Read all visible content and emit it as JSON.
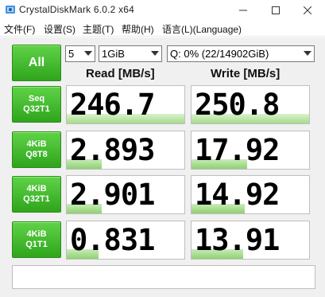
{
  "window": {
    "title": "CrystalDiskMark 6.0.2 x64"
  },
  "menu": {
    "items": [
      "文件(F)",
      "设置(S)",
      "主题(T)",
      "帮助(H)",
      "语言(L)(Language)"
    ]
  },
  "controls": {
    "all_label": "All",
    "count_value": "5",
    "size_value": "1GiB",
    "drive_value": "Q: 0% (22/14902GiB)"
  },
  "headers": {
    "read": "Read [MB/s]",
    "write": "Write [MB/s]"
  },
  "tests": [
    {
      "line1": "Seq",
      "line2": "Q32T1",
      "read": "246.7",
      "write": "250.8"
    },
    {
      "line1": "4KiB",
      "line2": "Q8T8",
      "read": "2.893",
      "write": "17.92"
    },
    {
      "line1": "4KiB",
      "line2": "Q32T1",
      "read": "2.901",
      "write": "14.92"
    },
    {
      "line1": "4KiB",
      "line2": "Q1T1",
      "read": "0.831",
      "write": "13.91"
    }
  ],
  "bar_fill_fraction": {
    "read": [
      1.0,
      0.3,
      0.3,
      0.27
    ],
    "write": [
      1.0,
      0.47,
      0.45,
      0.44
    ]
  },
  "colors": {
    "button_green": "#3dbb28",
    "bar_green": "#a6dc8c"
  },
  "comment": ""
}
